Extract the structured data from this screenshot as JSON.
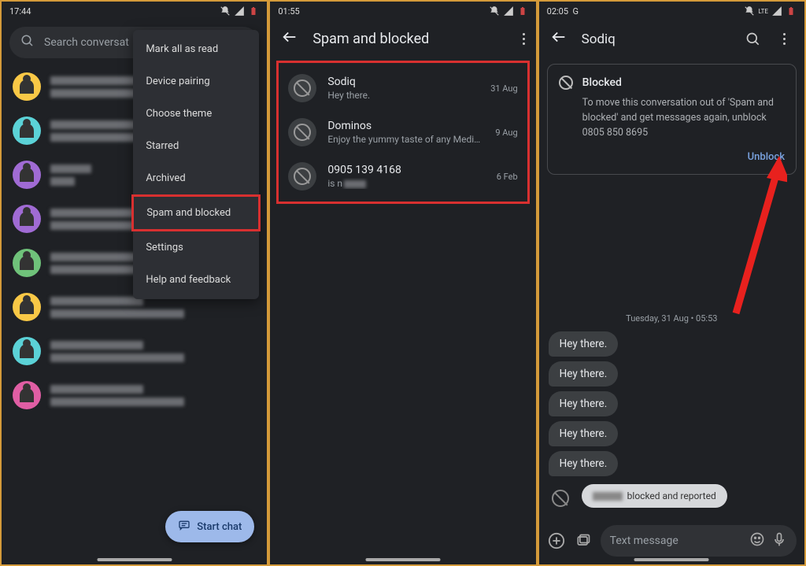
{
  "screen1": {
    "time": "17:44",
    "search_placeholder": "Search conversat",
    "menu": {
      "items": [
        "Mark all as read",
        "Device pairing",
        "Choose theme",
        "Starred",
        "Archived",
        "Spam and blocked",
        "Settings",
        "Help and feedback"
      ],
      "highlighted_index": 5
    },
    "fab_label": "Start chat"
  },
  "screen2": {
    "time": "01:55",
    "title": "Spam and blocked",
    "items": [
      {
        "name": "Sodiq",
        "preview": "Hey there.",
        "date": "31 Aug"
      },
      {
        "name": "Dominos",
        "preview": "Enjoy the yummy taste of any Medium …",
        "date": "9 Aug"
      },
      {
        "name": "0905 139 4168",
        "preview": "is n",
        "date": "6 Feb",
        "blurred_tail": true
      }
    ]
  },
  "screen3": {
    "time": "02:05",
    "status_extra": "G",
    "net_label": "LTE",
    "title": "Sodiq",
    "card": {
      "heading": "Blocked",
      "body": "To move this conversation out of 'Spam and blocked' and get messages again, unblock 0805 850 8695",
      "action": "Unblock"
    },
    "date_label": "Tuesday, 31 Aug • 05:53",
    "bubbles": [
      "Hey there.",
      "Hey there.",
      "Hey there.",
      "Hey there.",
      "Hey there."
    ],
    "toast": "blocked and reported",
    "compose_placeholder": "Text message"
  }
}
